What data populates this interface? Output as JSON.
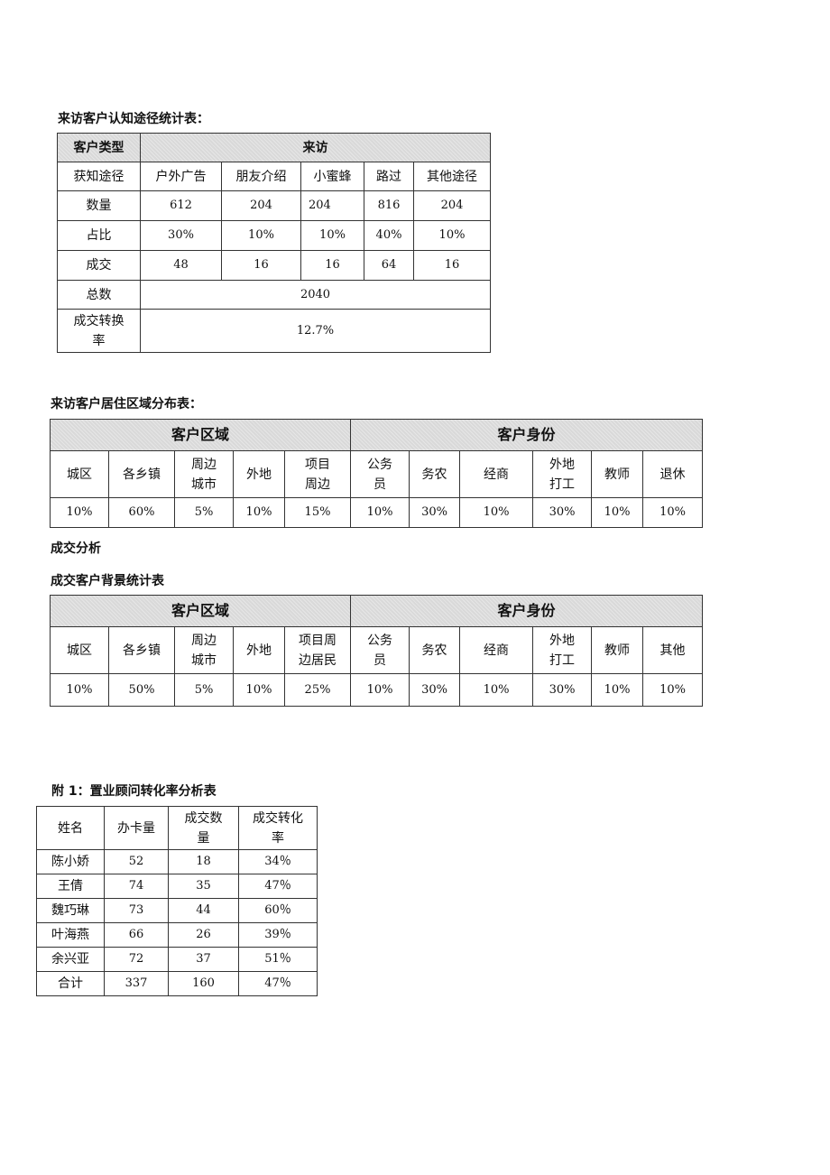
{
  "table1": {
    "title": "来访客户认知途径统计表：",
    "header_left": "客户类型",
    "header_span": "来访",
    "channel_row_label": "获知途径",
    "channels": [
      "户外广告",
      "朋友介绍",
      "小蜜蜂",
      "路过",
      "其他途径"
    ],
    "rows": [
      {
        "label": "数量",
        "values": [
          "612",
          "204",
          "204",
          "816",
          "204"
        ]
      },
      {
        "label": "占比",
        "values": [
          "30%",
          "10%",
          "10%",
          "40%",
          "10%"
        ]
      },
      {
        "label": "成交",
        "values": [
          "48",
          "16",
          "16",
          "64",
          "16"
        ]
      }
    ],
    "total_label": "总数",
    "total_value": "2040",
    "rate_label": "成交转换率",
    "rate_value": "12.7%"
  },
  "table2": {
    "title": "来访客户居住区域分布表：",
    "group1": "客户区域",
    "group2": "客户身份",
    "columns": [
      "城区",
      "各乡镇",
      "周边城市",
      "外地",
      "项目周边",
      "公务员",
      "务农",
      "经商",
      "外地打工",
      "教师",
      "退休"
    ],
    "values": [
      "10%",
      "60%",
      "5%",
      "10%",
      "15%",
      "10%",
      "30%",
      "10%",
      "30%",
      "10%",
      "10%"
    ]
  },
  "section_title": "成交分析",
  "table3": {
    "title": "成交客户背景统计表",
    "group1": "客户区域",
    "group2": "客户身份",
    "columns": [
      "城区",
      "各乡镇",
      "周边城市",
      "外地",
      "项目周边居民",
      "公务员",
      "务农",
      "经商",
      "外地打工",
      "教师",
      "其他"
    ],
    "values": [
      "10%",
      "50%",
      "5%",
      "10%",
      "25%",
      "10%",
      "30%",
      "10%",
      "30%",
      "10%",
      "10%"
    ]
  },
  "table4": {
    "title": "附 1：置业顾问转化率分析表",
    "headers": [
      "姓名",
      "办卡量",
      "成交数量",
      "成交转化率"
    ],
    "rows": [
      [
        "陈小娇",
        "52",
        "18",
        "34％"
      ],
      [
        "王倩",
        "74",
        "35",
        "47％"
      ],
      [
        "魏巧琳",
        "73",
        "44",
        "60％"
      ],
      [
        "叶海燕",
        "66",
        "26",
        "39％"
      ],
      [
        "余兴亚",
        "72",
        "37",
        "51％"
      ],
      [
        "合计",
        "337",
        "160",
        "47％"
      ]
    ]
  }
}
